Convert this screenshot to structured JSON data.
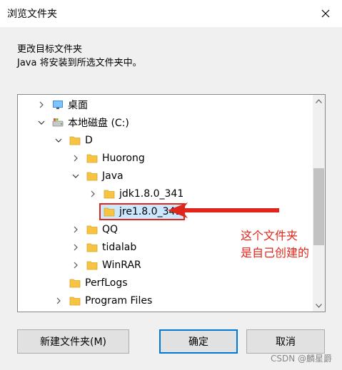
{
  "window": {
    "title": "浏览文件夹",
    "close_label": "×"
  },
  "description": {
    "line1": "更改目标文件夹",
    "line2": "Java 将安装到所选文件夹中。"
  },
  "tree": {
    "items": [
      {
        "label": "桌面",
        "icon": "desktop-folder-icon",
        "expander": "collapsed"
      },
      {
        "label": "本地磁盘 (C:)",
        "icon": "drive-icon",
        "expander": "expanded"
      },
      {
        "label": "D",
        "icon": "folder-icon",
        "expander": "expanded"
      },
      {
        "label": "Huorong",
        "icon": "folder-icon",
        "expander": "collapsed"
      },
      {
        "label": "Java",
        "icon": "folder-icon",
        "expander": "expanded"
      },
      {
        "label": "jdk1.8.0_341",
        "icon": "folder-icon",
        "expander": "collapsed"
      },
      {
        "label": "jre1.8.0_341",
        "icon": "folder-icon",
        "expander": "none",
        "selected": true
      },
      {
        "label": "QQ",
        "icon": "folder-icon",
        "expander": "collapsed"
      },
      {
        "label": "tidalab",
        "icon": "folder-icon",
        "expander": "collapsed"
      },
      {
        "label": "WinRAR",
        "icon": "folder-icon",
        "expander": "collapsed"
      },
      {
        "label": "PerfLogs",
        "icon": "folder-icon",
        "expander": "none"
      },
      {
        "label": "Program Files",
        "icon": "folder-icon",
        "expander": "collapsed"
      }
    ]
  },
  "annotation": {
    "line1": "这个文件夹",
    "line2": "是自己创建的",
    "color": "#e0261a"
  },
  "buttons": {
    "new_folder": "新建文件夹(M)",
    "ok": "确定",
    "cancel": "取消"
  },
  "watermark": "CSDN @麟星爵",
  "colors": {
    "folder": "#f6c342",
    "selection": "#cce8ff",
    "annotation": "#e0261a",
    "accent": "#0078d7"
  }
}
